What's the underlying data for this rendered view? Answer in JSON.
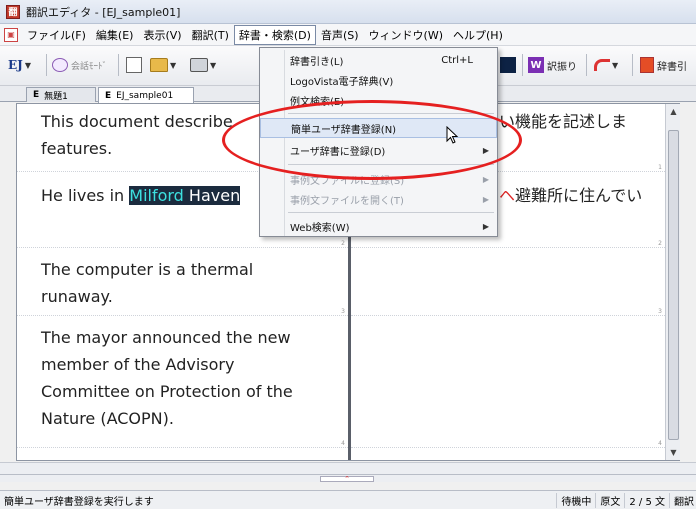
{
  "window": {
    "title": "翻訳エディタ - [EJ_sample01]"
  },
  "menubar": {
    "items": [
      "ファイル(F)",
      "編集(E)",
      "表示(V)",
      "翻訳(T)",
      "辞書・検索(D)",
      "音声(S)",
      "ウィンドウ(W)",
      "ヘルプ(H)"
    ],
    "active_index": 4
  },
  "toolbar": {
    "ej_mark": "EJ",
    "conversation_mode": "会話ﾓｰﾄﾞ",
    "translate_label": "訳振り",
    "dictionary_label": "辞書引"
  },
  "tabs": [
    {
      "prefix": "E",
      "label": "無題1",
      "active": false
    },
    {
      "prefix": "E",
      "label": "EJ_sample01",
      "active": true
    }
  ],
  "dropdown": {
    "items": [
      {
        "label": "辞書引き(L)",
        "shortcut": "Ctrl+L",
        "disabled": false,
        "submenu": false
      },
      {
        "label": "LogoVista電子辞典(V)",
        "shortcut": "",
        "disabled": false,
        "submenu": false
      },
      {
        "label": "例文検索(E)",
        "shortcut": "",
        "disabled": false,
        "submenu": false
      },
      {
        "label": "簡単ユーザ辞書登録(N)",
        "shortcut": "",
        "disabled": false,
        "submenu": false,
        "hover": true
      },
      {
        "label": "ユーザ辞書に登録(D)",
        "shortcut": "",
        "disabled": false,
        "submenu": true
      },
      {
        "label": "事例文ファイルに登録(S)",
        "shortcut": "",
        "disabled": true,
        "submenu": true
      },
      {
        "label": "事例文ファイルを開く(T)",
        "shortcut": "",
        "disabled": true,
        "submenu": true
      },
      {
        "label": "Web検索(W)",
        "shortcut": "",
        "disabled": false,
        "submenu": true
      }
    ]
  },
  "editor": {
    "source": {
      "seg1_line1": "This document describe",
      "seg1_line2": "features.",
      "seg2_pre": "He lives in ",
      "seg2_hl1": "Milford",
      "seg2_hl2": " Haven",
      "seg3_line1": "The computer is a thermal",
      "seg3_line2": "runaway.",
      "seg4_line1": "The mayor announced the new",
      "seg4_line2": "member of the Advisory",
      "seg4_line3": "Committee on Protection of the",
      "seg4_line4": "Nature (ACOPN)."
    },
    "target": {
      "seg1": "い機能を記述しま",
      "seg2_red": "ヘ",
      "seg2": "避難所に住んでい"
    },
    "segment_numbers": [
      "1",
      "2",
      "3",
      "4",
      "1",
      "2",
      "3",
      "4"
    ]
  },
  "statusbar": {
    "message": "簡単ユーザ辞書登録を実行します",
    "state": "待機中",
    "source_label": "原文",
    "sentence_count": "2 / 5 文",
    "translate_label": "翻訳"
  },
  "colors": {
    "highlight_bg": "#1b2b3e",
    "highlight_fg": "#3de0e0",
    "annotation": "#e52020"
  }
}
